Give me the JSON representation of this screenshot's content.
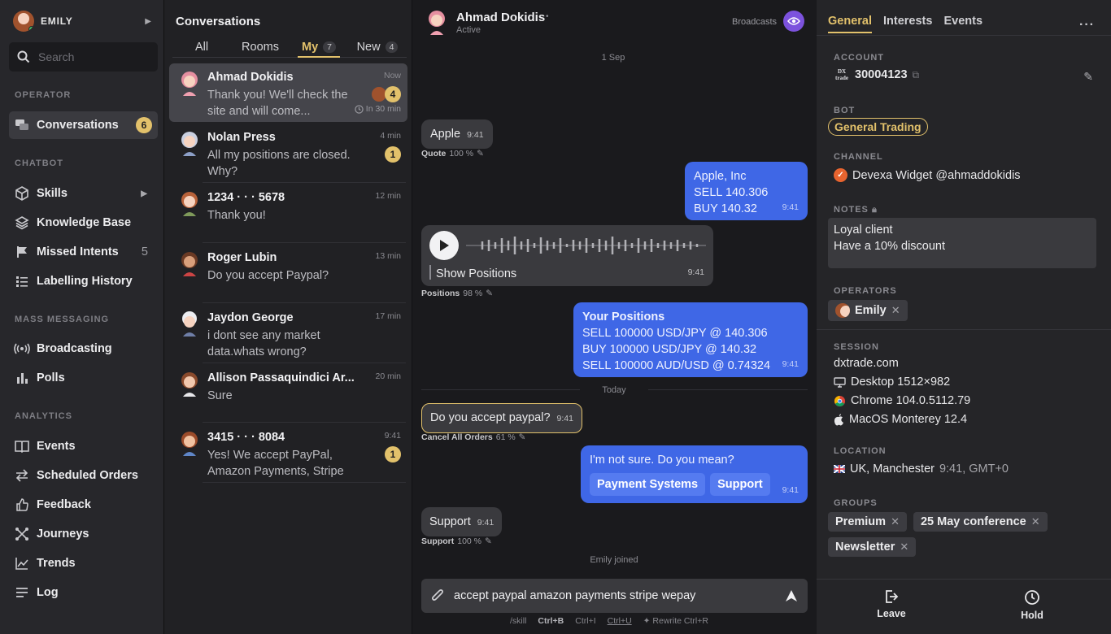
{
  "user": {
    "name": "EMILY"
  },
  "search": {
    "placeholder": "Search"
  },
  "sidebar": {
    "operator_label": "OPERATOR",
    "conversations": {
      "label": "Conversations",
      "count": "6"
    },
    "chatbot_label": "CHATBOT",
    "skills": "Skills",
    "knowledge_base": "Knowledge Base",
    "missed_intents": {
      "label": "Missed Intents",
      "count": "5"
    },
    "labelling_history": "Labelling History",
    "mass_label": "MASS MESSAGING",
    "broadcasting": "Broadcasting",
    "polls": "Polls",
    "analytics_label": "ANALYTICS",
    "events": "Events",
    "scheduled_orders": "Scheduled Orders",
    "feedback": "Feedback",
    "journeys": "Journeys",
    "trends": "Trends",
    "log": "Log"
  },
  "conversations": {
    "title": "Conversations",
    "tabs": [
      {
        "label": "All",
        "count": ""
      },
      {
        "label": "Rooms",
        "count": ""
      },
      {
        "label": "My",
        "count": "7"
      },
      {
        "label": "New",
        "count": "4"
      }
    ],
    "items": [
      {
        "name": "Ahmad Dokidis",
        "msg": "Thank you! We'll check the site and will come...",
        "time": "Now",
        "badge": "4",
        "sub": "In 30 min"
      },
      {
        "name": "Nolan Press",
        "msg": "All my positions are closed. Why?",
        "time": "4 min",
        "badge": "1"
      },
      {
        "name": "1234 · · · 5678",
        "msg": "Thank you!",
        "time": "12 min"
      },
      {
        "name": "Roger Lubin",
        "msg": "Do you accept Paypal?",
        "time": "13 min"
      },
      {
        "name": "Jaydon George",
        "msg": "i dont see any market data.whats wrong?",
        "time": "17 min"
      },
      {
        "name": "Allison Passaquindici Ar...",
        "msg": "Sure",
        "time": "20 min"
      },
      {
        "name": "3415 · · · 8084",
        "msg": "Yes! We accept PayPal, Amazon Payments, Stripe an...",
        "time": "9:41",
        "badge": "1"
      }
    ]
  },
  "chat": {
    "contact_name": "Ahmad Dokidis",
    "status": "Active",
    "broadcasts": "Broadcasts",
    "date1": "1 Sep",
    "msg1": {
      "text": "Apple",
      "time": "9:41",
      "meta_label": "Quote",
      "meta_pct": "100 %"
    },
    "msg2": {
      "line1": "Apple, Inc",
      "line2": "SELL 140.306",
      "line3": "BUY 140.32",
      "time": "9:41"
    },
    "voice": {
      "caption": "Show Positions",
      "time": "9:41",
      "meta_label": "Positions",
      "meta_pct": "98 %"
    },
    "msg3": {
      "title": "Your Positions",
      "line1": "SELL 100000 USD/JPY @ 140.306",
      "line2": "BUY 100000 USD/JPY @ 140.32",
      "line3": "SELL 100000 AUD/USD @ 0.74324",
      "time": "9:41"
    },
    "date2": "Today",
    "msg4": {
      "text": "Do you accept paypal?",
      "time": "9:41",
      "meta_label": "Cancel All Orders",
      "meta_pct": "61 %"
    },
    "msg5": {
      "text": "I'm not sure. Do you mean?",
      "btn1": "Payment Systems",
      "btn2": "Support",
      "time": "9:41"
    },
    "msg6": {
      "text": "Support",
      "time": "9:41",
      "meta_label": "Support",
      "meta_pct": "100 %"
    },
    "joined": "Emily joined",
    "composer_value": "accept paypal amazon payments stripe wepay",
    "shortcuts": [
      {
        "key": "/skill",
        "label": ""
      },
      {
        "key": "Ctrl+B",
        "label": ""
      },
      {
        "key": "Ctrl+I",
        "label": ""
      },
      {
        "key": "Ctrl+U",
        "label": ""
      },
      {
        "key": "Rewrite Ctrl+R",
        "label": ""
      }
    ]
  },
  "details": {
    "tabs": [
      "General",
      "Interests",
      "Events"
    ],
    "account_label": "ACCOUNT",
    "account_logo": "DX trade",
    "account_number": "30004123",
    "bot_label": "BOT",
    "bot": "General Trading",
    "channel_label": "CHANNEL",
    "channel": "Devexa Widget @ahmaddokidis",
    "notes_label": "NOTES",
    "notes_line1": "Loyal client",
    "notes_line2": "Have a 10% discount",
    "operators_label": "OPERATORS",
    "operator": "Emily",
    "session_label": "SESSION",
    "domain": "dxtrade.com",
    "device": "Desktop 1512×982",
    "browser": "Chrome 104.0.5112.79",
    "os": "MacOS Monterey 12.4",
    "location_label": "LOCATION",
    "location": "UK, Manchester",
    "location_time": "9:41, GMT+0",
    "groups_label": "GROUPS",
    "groups": [
      "Premium",
      "25 May conference",
      "Newsletter"
    ],
    "leave": "Leave",
    "hold": "Hold"
  },
  "colors": {
    "accent": "#e2c16b",
    "outgoing": "#3f67e6",
    "online": "#3ec36b",
    "broadcast": "#7c52dd"
  }
}
